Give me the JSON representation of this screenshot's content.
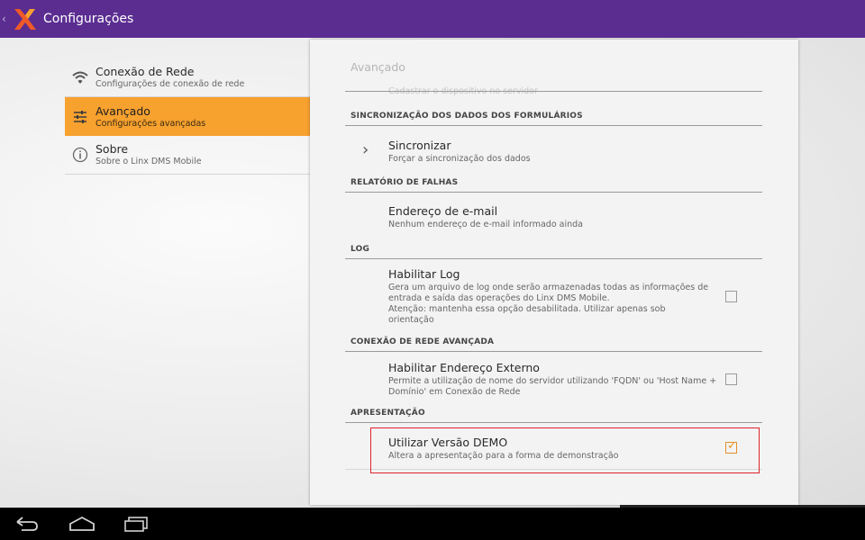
{
  "actionbar": {
    "title": "Configurações",
    "up_icon": "chevron-left-icon",
    "logo": "app-logo",
    "colors": {
      "bar": "#5b2d91",
      "logo_orange": "#f05a28"
    }
  },
  "headers": [
    {
      "title": "Conexão de Rede",
      "summary": "Configurações de conexão de rede",
      "icon": "wifi-icon",
      "active": false
    },
    {
      "title": "Avançado",
      "summary": "Configurações avançadas",
      "icon": "sliders-icon",
      "active": true
    },
    {
      "title": "Sobre",
      "summary": "Sobre o Linx DMS Mobile",
      "icon": "info-icon",
      "active": false
    }
  ],
  "panel": {
    "title": "Avançado",
    "faded_text": "Cadastrar o dispositivo no servidor",
    "categories": {
      "sync": "SINCRONIZAÇÃO DOS DADOS DOS FORMULÁRIOS",
      "crash": "RELATÓRIO DE FALHAS",
      "log": "LOG",
      "network": "CONEXÃO DE REDE AVANÇADA",
      "presentation": "APRESENTAÇÃO"
    },
    "prefs": {
      "sync": {
        "title": "Sincronizar",
        "summary": "Forçar a sincronização dos dados"
      },
      "email": {
        "title": "Endereço de e-mail",
        "summary": "Nenhum endereço de e-mail informado ainda"
      },
      "log": {
        "title": "Habilitar Log",
        "summary_lines": [
          "Gera um arquivo de log onde serão armazenadas todas as informações de",
          "entrada e saída das operações do Linx DMS Mobile.",
          "Atenção: mantenha essa opção desabilitada. Utilizar apenas sob",
          "orientação"
        ],
        "checked": false
      },
      "external": {
        "title": "Habilitar Endereço Externo",
        "summary_lines": [
          "Permite a utilização de nome do servidor utilizando 'FQDN' ou 'Host Name +",
          "Domínio' em Conexão de Rede"
        ],
        "checked": false
      },
      "demo": {
        "title": "Utilizar Versão DEMO",
        "summary": "Altera a apresentação para a forma de demonstração",
        "checked": true
      }
    },
    "highlight_color": "#e0222a",
    "accent_color": "#f7a12f"
  },
  "navbar": {
    "buttons": [
      "back-icon",
      "home-icon",
      "recent-apps-icon"
    ]
  }
}
